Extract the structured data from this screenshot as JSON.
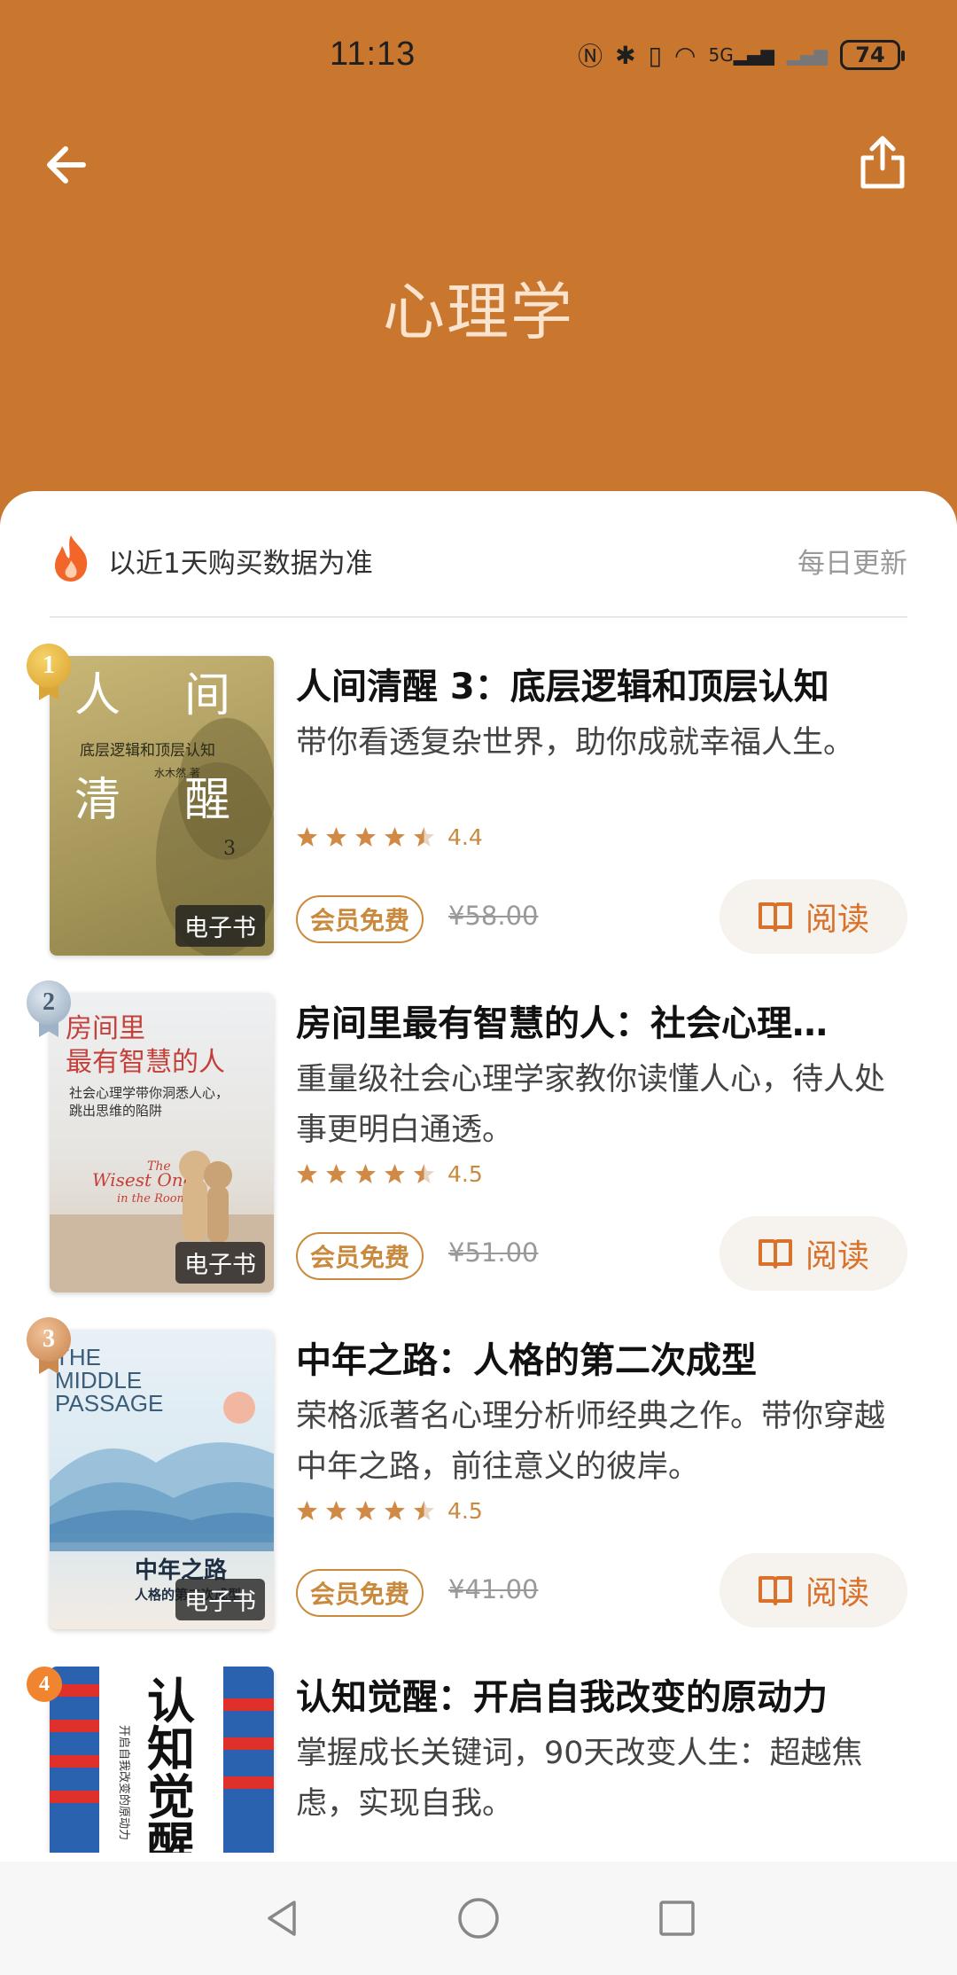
{
  "status_bar": {
    "time": "11:13",
    "battery": "74",
    "icons": [
      "nfc-icon",
      "bluetooth-icon",
      "vibrate-icon",
      "wifi-icon",
      "5g-signal-icon",
      "signal-icon"
    ]
  },
  "header": {
    "title": "心理学",
    "back_icon": "back-arrow-icon",
    "share_icon": "share-icon"
  },
  "list_header": {
    "basis_text": "以近1天购买数据为准",
    "update_text": "每日更新"
  },
  "books": [
    {
      "rank": "1",
      "title": "人间清醒 3：底层逻辑和顶层认知",
      "desc": "带你看透复杂世界，助你成就幸福人生。",
      "score": "4.4",
      "stars": 4.5,
      "vip": "会员免费",
      "price": "¥58.00",
      "read": "阅读",
      "cover_tag": "电子书",
      "cover_texts": [
        "人",
        "间",
        "清",
        "醒",
        "底层逻辑和顶层认知",
        "水木然 著",
        "3"
      ]
    },
    {
      "rank": "2",
      "title": "房间里最有智慧的人：社会心理…",
      "desc": "重量级社会心理学家教你读懂人心，待人处事更明白通透。",
      "score": "4.5",
      "stars": 4.5,
      "vip": "会员免费",
      "price": "¥51.00",
      "read": "阅读",
      "cover_tag": "电子书",
      "cover_texts": [
        "房间里",
        "最有智慧的人",
        "社会心理学带你洞悉人心，",
        "跳出思维的陷阱",
        "The",
        "Wisest One",
        "in the Room"
      ]
    },
    {
      "rank": "3",
      "title": "中年之路：人格的第二次成型",
      "desc": "荣格派著名心理分析师经典之作。带你穿越中年之路，前往意义的彼岸。",
      "score": "4.5",
      "stars": 4.5,
      "vip": "会员免费",
      "price": "¥41.00",
      "read": "阅读",
      "cover_tag": "电子书",
      "cover_texts": [
        "THE",
        "MIDDLE",
        "PASSAGE",
        "中年之路",
        "人格的第二次成型"
      ]
    },
    {
      "rank": "4",
      "title": "认知觉醒：开启自我改变的原动力",
      "desc": "掌握成长关键词，90天改变人生：超越焦虑，实现自我。",
      "cover_texts": [
        "认",
        "知",
        "觉",
        "醒",
        "开启自我改变的原动力"
      ]
    }
  ],
  "colors": {
    "header_bg": "#c9772e",
    "accent": "#d9712a",
    "gold": "#c98a3d"
  },
  "nav": [
    "back-nav-icon",
    "home-nav-icon",
    "recents-nav-icon"
  ]
}
